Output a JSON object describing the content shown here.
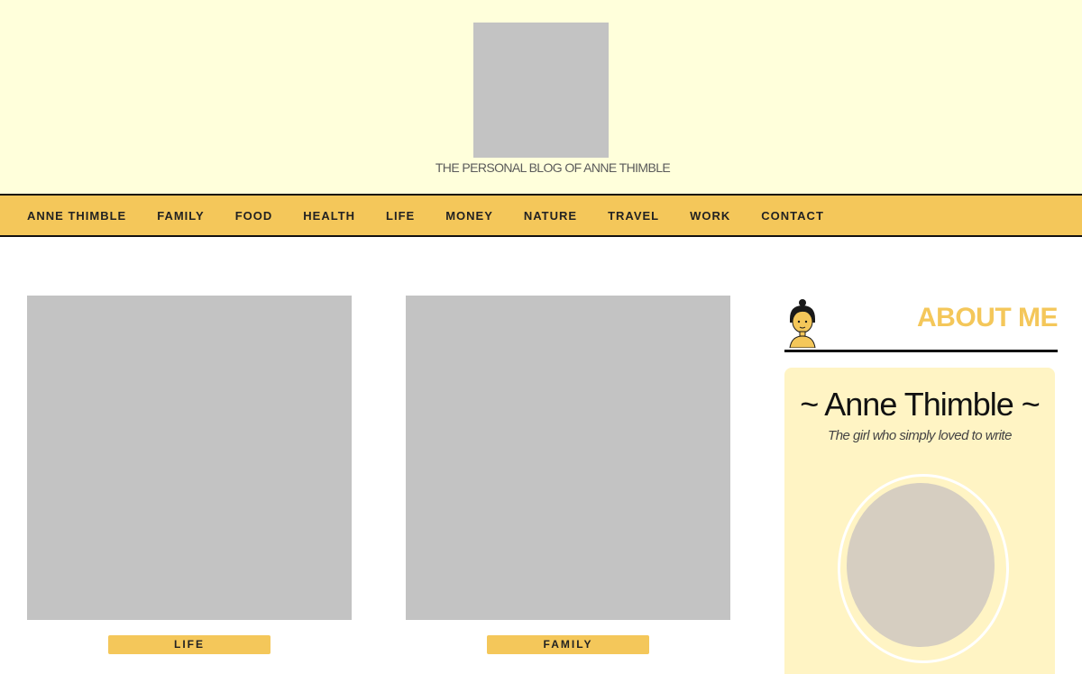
{
  "header": {
    "tagline": "THE PERSONAL BLOG OF ANNE THIMBLE"
  },
  "nav": {
    "items": [
      "ANNE THIMBLE",
      "FAMILY",
      "FOOD",
      "HEALTH",
      "LIFE",
      "MONEY",
      "NATURE",
      "TRAVEL",
      "WORK",
      "CONTACT"
    ]
  },
  "posts": [
    {
      "category": "LIFE"
    },
    {
      "category": "FAMILY"
    }
  ],
  "sidebar": {
    "about_title": "ABOUT ME",
    "name": "~ Anne Thimble ~",
    "subtitle": "The girl who simply loved to write"
  },
  "colors": {
    "header_bg": "#ffffdb",
    "accent": "#f4c75a",
    "card_bg": "#fff4c4"
  }
}
